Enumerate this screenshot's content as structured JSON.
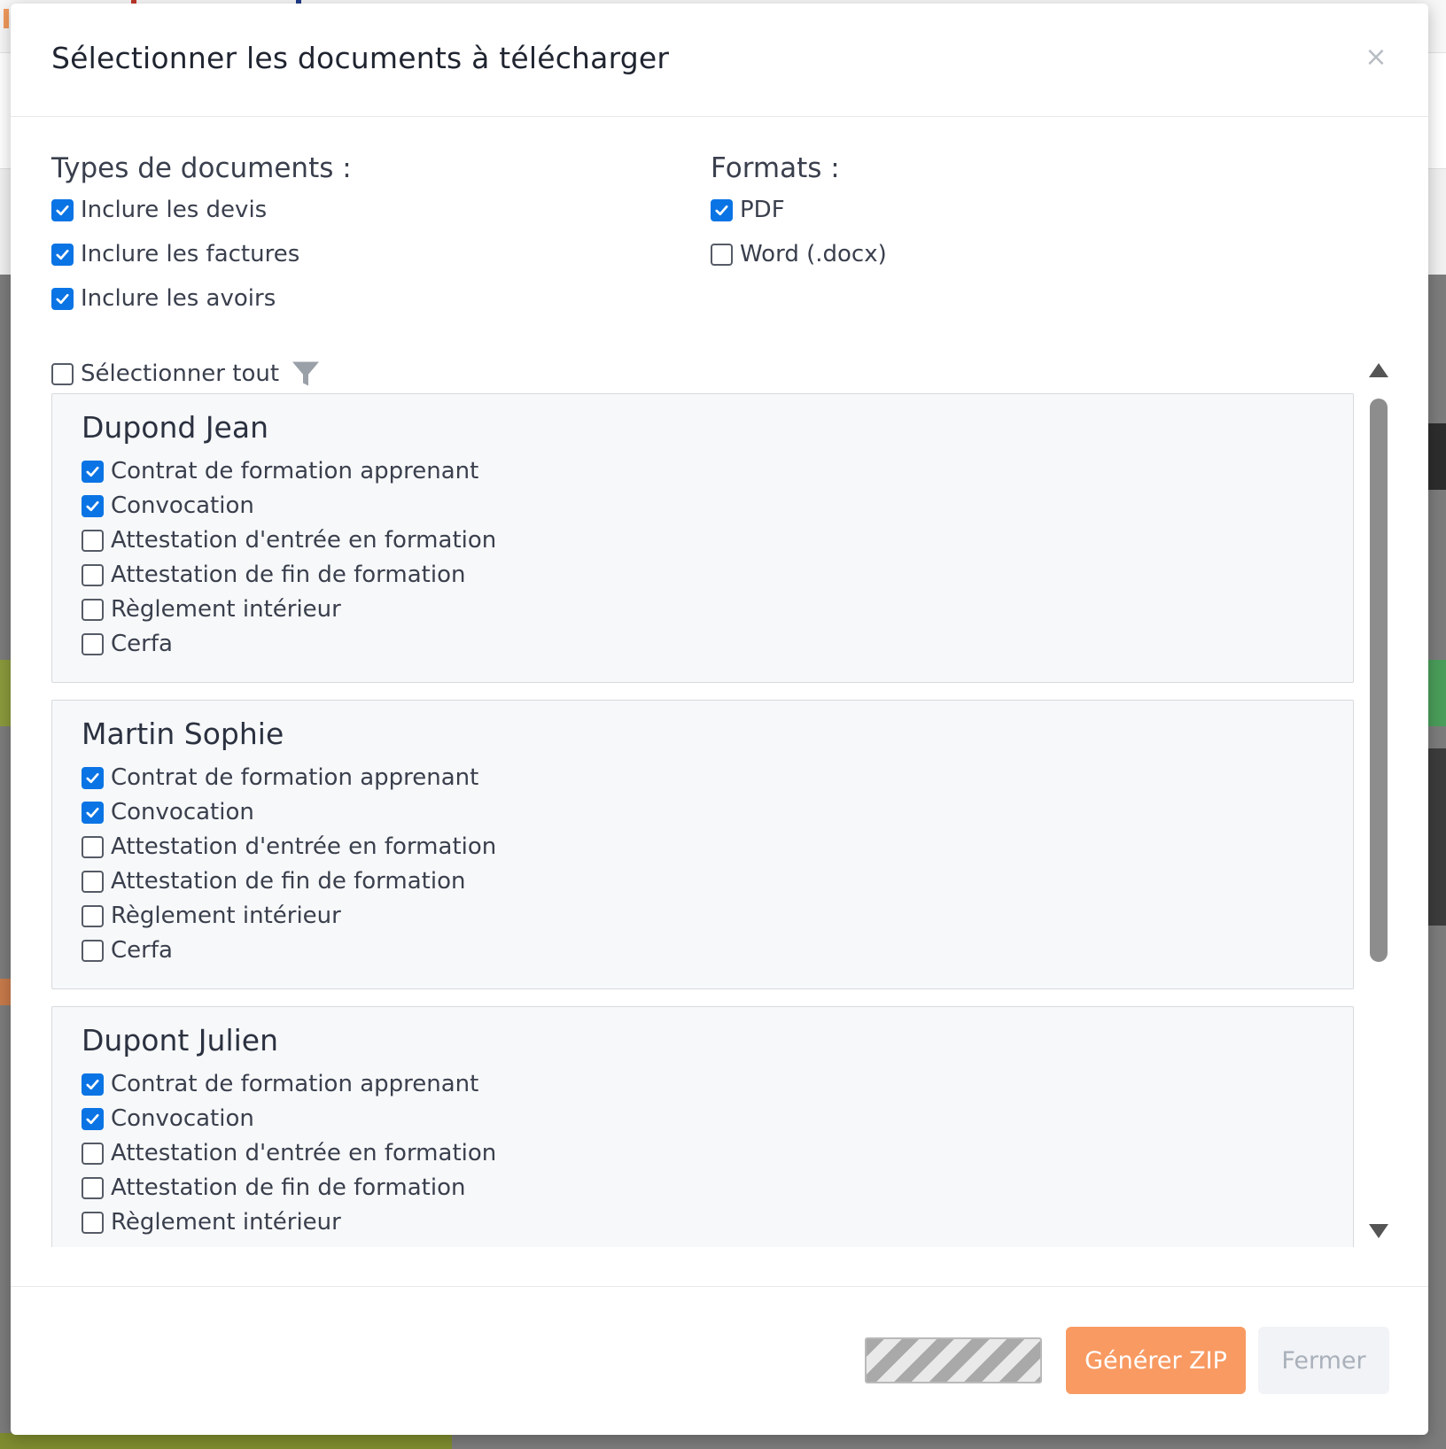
{
  "modal": {
    "title": "Sélectionner les documents à télécharger",
    "close_glyph": "×"
  },
  "doc_types": {
    "title": "Types de documents :",
    "items": [
      {
        "label": "Inclure les devis",
        "checked": true
      },
      {
        "label": "Inclure les factures",
        "checked": true
      },
      {
        "label": "Inclure les avoirs",
        "checked": true
      }
    ]
  },
  "formats": {
    "title": "Formats :",
    "items": [
      {
        "label": "PDF",
        "checked": true
      },
      {
        "label": "Word (.docx)",
        "checked": false
      }
    ]
  },
  "select_all": {
    "label": "Sélectionner tout",
    "checked": false
  },
  "learners": [
    {
      "name": "Dupond Jean",
      "documents": [
        {
          "label": "Contrat de formation apprenant",
          "checked": true
        },
        {
          "label": "Convocation",
          "checked": true
        },
        {
          "label": "Attestation d'entrée en formation",
          "checked": false
        },
        {
          "label": "Attestation de fin de formation",
          "checked": false
        },
        {
          "label": "Règlement intérieur",
          "checked": false
        },
        {
          "label": "Cerfa",
          "checked": false
        }
      ]
    },
    {
      "name": "Martin Sophie",
      "documents": [
        {
          "label": "Contrat de formation apprenant",
          "checked": true
        },
        {
          "label": "Convocation",
          "checked": true
        },
        {
          "label": "Attestation d'entrée en formation",
          "checked": false
        },
        {
          "label": "Attestation de fin de formation",
          "checked": false
        },
        {
          "label": "Règlement intérieur",
          "checked": false
        },
        {
          "label": "Cerfa",
          "checked": false
        }
      ]
    },
    {
      "name": "Dupont Julien",
      "documents": [
        {
          "label": "Contrat de formation apprenant",
          "checked": true
        },
        {
          "label": "Convocation",
          "checked": true
        },
        {
          "label": "Attestation d'entrée en formation",
          "checked": false
        },
        {
          "label": "Attestation de fin de formation",
          "checked": false
        },
        {
          "label": "Règlement intérieur",
          "checked": false
        }
      ]
    }
  ],
  "footer": {
    "generate_label": "Générer ZIP",
    "close_label": "Fermer"
  },
  "colors": {
    "accent": "#0b74e5",
    "primary_button": "#f89a62"
  },
  "icons": {
    "checkbox_checked": "check-icon",
    "filter": "filter-icon",
    "close": "close-icon",
    "scroll_up": "arrow-up-icon",
    "scroll_down": "arrow-down-icon"
  }
}
